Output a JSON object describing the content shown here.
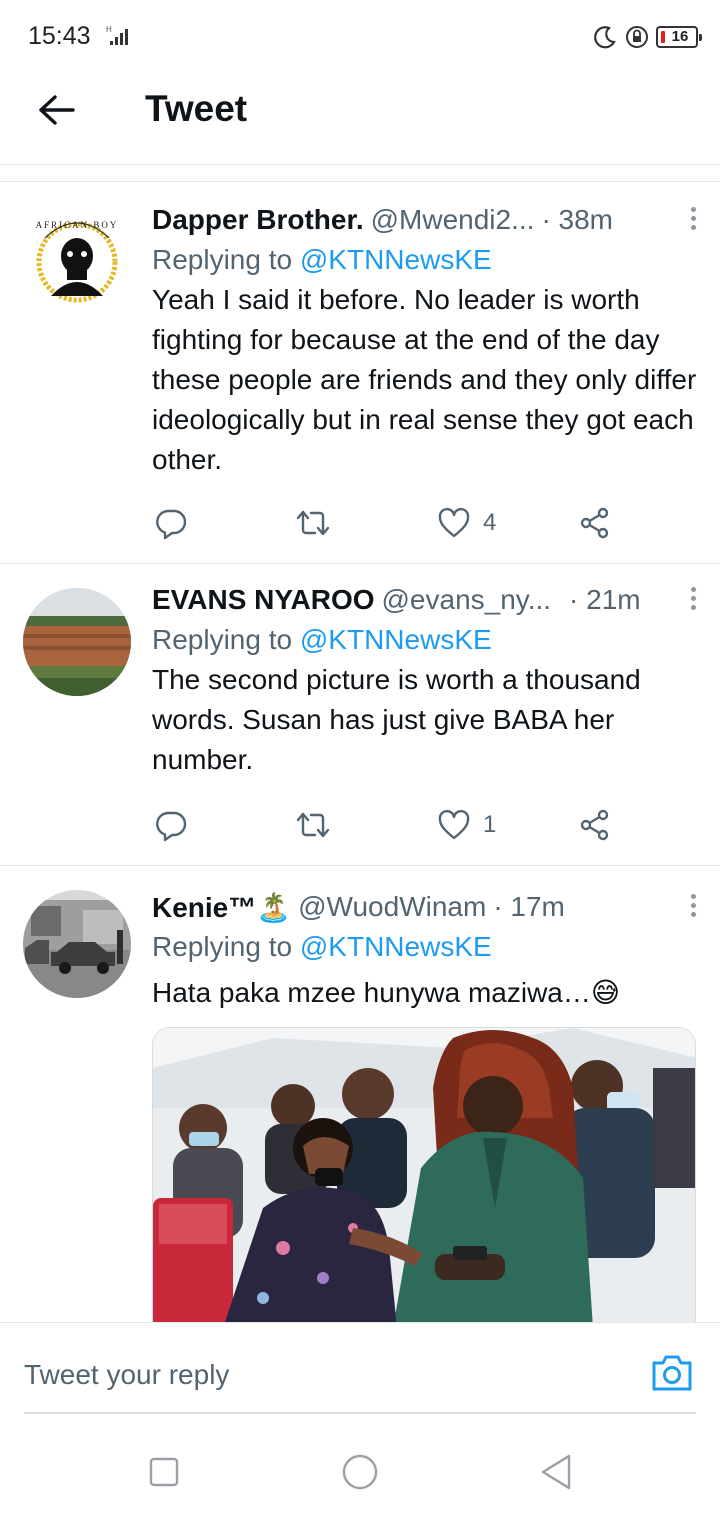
{
  "status_bar": {
    "time": "15:43",
    "network": "H",
    "battery": "16",
    "icons": [
      "signal-icon",
      "moon-icon",
      "lock-rotation-icon",
      "battery-icon"
    ]
  },
  "header": {
    "title": "Tweet",
    "back_icon": "arrow-left-icon"
  },
  "tweets": [
    {
      "name": "Dapper Brother.",
      "handle": "@Mwendi2...",
      "time": "· 38m",
      "replying_prefix": "Replying to ",
      "replying_to": "@KTNNewsKE",
      "text": "Yeah I said it before. No leader is worth fighting for because at the end of the day these people are friends and they only differ ideologically but in real sense they got each other.",
      "likes": "4"
    },
    {
      "name": "EVANS NYAROO",
      "handle": "@evans_ny...",
      "time": "· 21m",
      "replying_prefix": "Replying to ",
      "replying_to": "@KTNNewsKE",
      "text": "The second picture is worth a thousand words. Susan has just give BABA her number.",
      "likes": "1"
    },
    {
      "name": "Kenie™🏝️",
      "handle": "@WuodWinam",
      "time": "· 17m",
      "replying_prefix": "Replying to ",
      "replying_to": "@KTNNewsKE",
      "text": "Hata paka mzee hunywa maziwa…😅"
    }
  ],
  "reply_bar": {
    "placeholder": "Tweet your reply",
    "camera_icon": "camera-icon"
  },
  "nav": {
    "icons": [
      "recents-square-icon",
      "home-circle-icon",
      "back-triangle-icon"
    ]
  },
  "colors": {
    "accent": "#1d9bf0",
    "text": "#0f1419",
    "secondary": "#536471",
    "divider": "#e1e6ea"
  }
}
